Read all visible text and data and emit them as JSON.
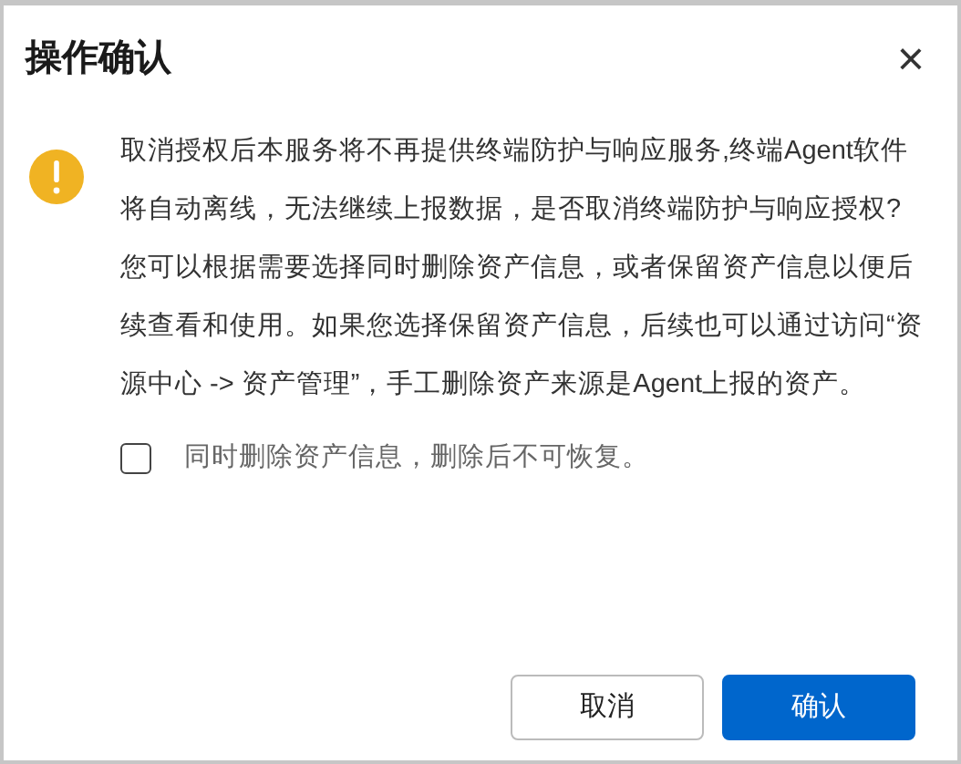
{
  "dialog": {
    "title": "操作确认",
    "close": "×"
  },
  "message": {
    "kind": "warning",
    "paragraphs": [
      "取消授权后本服务将不再提供终端防护与响应服务,终端Agent软件将自动离线，无法继续上报数据，是否取消终端防护与响应授权?",
      "您可以根据需要选择同时删除资产信息，或者保留资产信息以便后续查看和使用。如果您选择保留资产信息，后续也可以通过访问“资源中心 -> 资产管理”，手工删除资产来源是Agent上报的资产。"
    ]
  },
  "option": {
    "label": "同时删除资产信息，删除后不可恢复。",
    "checked": false
  },
  "buttons": [
    {
      "label": "取消",
      "kind": "secondary"
    },
    {
      "label": "确认",
      "kind": "primary"
    }
  ]
}
